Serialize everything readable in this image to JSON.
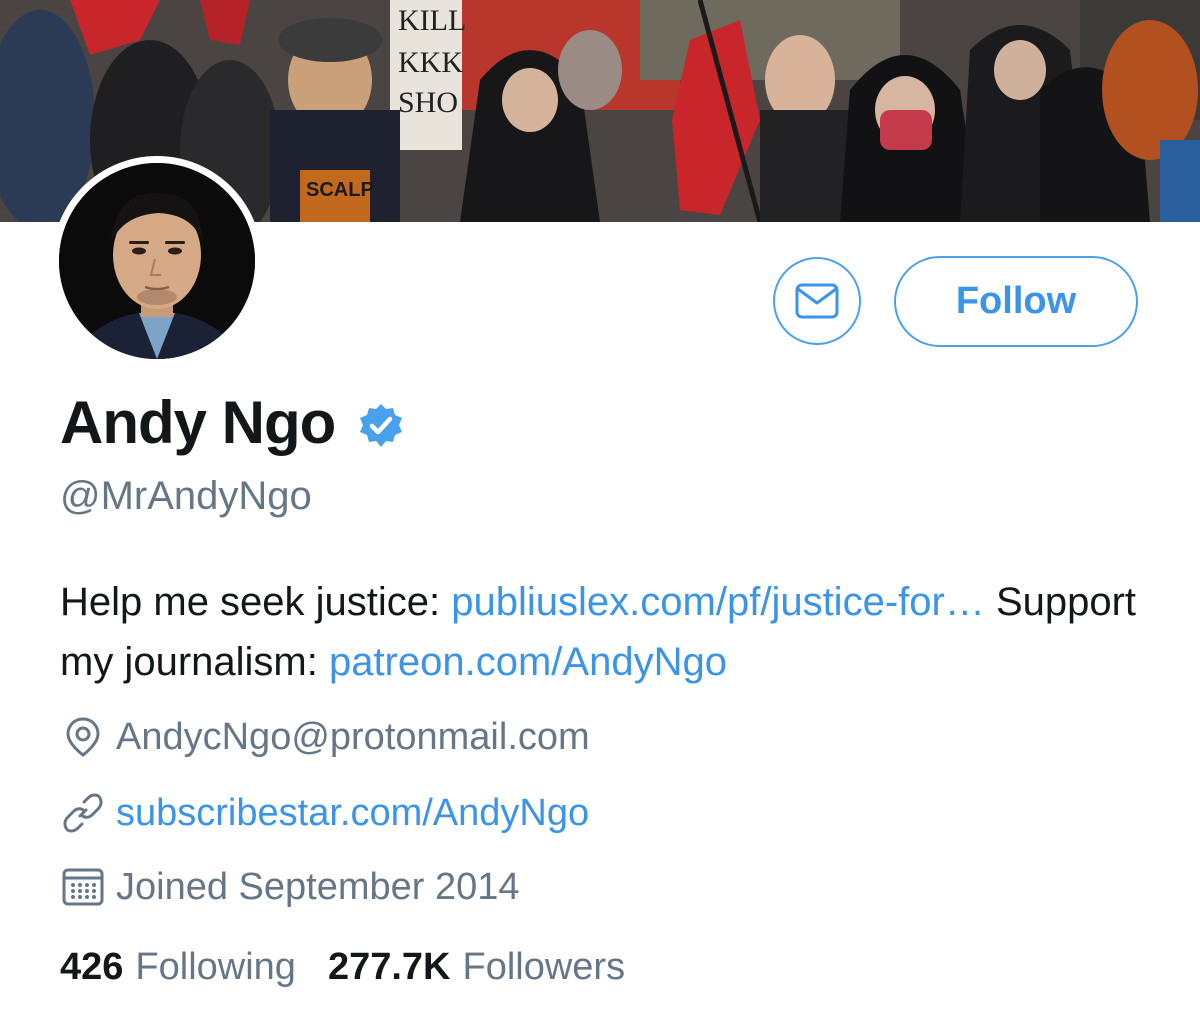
{
  "profile": {
    "name": "Andy Ngo",
    "handle": "@MrAndyNgo",
    "verified": true,
    "follow_label": "Follow",
    "bio": {
      "text1": "Help me seek justice: ",
      "link1": "publiuslex.com/pf/justice-for…",
      "text2": " Support my journalism: ",
      "link2": "patreon.com/AndyNgo"
    },
    "location": "AndycNgo@protonmail.com",
    "website": "subscribestar.com/AndyNgo",
    "joined": "Joined September 2014",
    "following_count": "426",
    "following_label": "Following",
    "followers_count": "277.7K",
    "followers_label": "Followers"
  },
  "banner": {
    "sign_text": [
      "KILL",
      "KKK",
      "SHO"
    ],
    "shirt_text": "SCALP"
  },
  "icons": {
    "message": "envelope-icon",
    "verified": "verified-badge-icon",
    "location": "location-pin-icon",
    "website": "link-icon",
    "joined": "calendar-icon"
  },
  "colors": {
    "accent": "#3b94e6",
    "text_primary": "#14171a",
    "text_secondary": "#657786",
    "verified": "#4aa1eb",
    "flag_red": "#c8262b"
  }
}
